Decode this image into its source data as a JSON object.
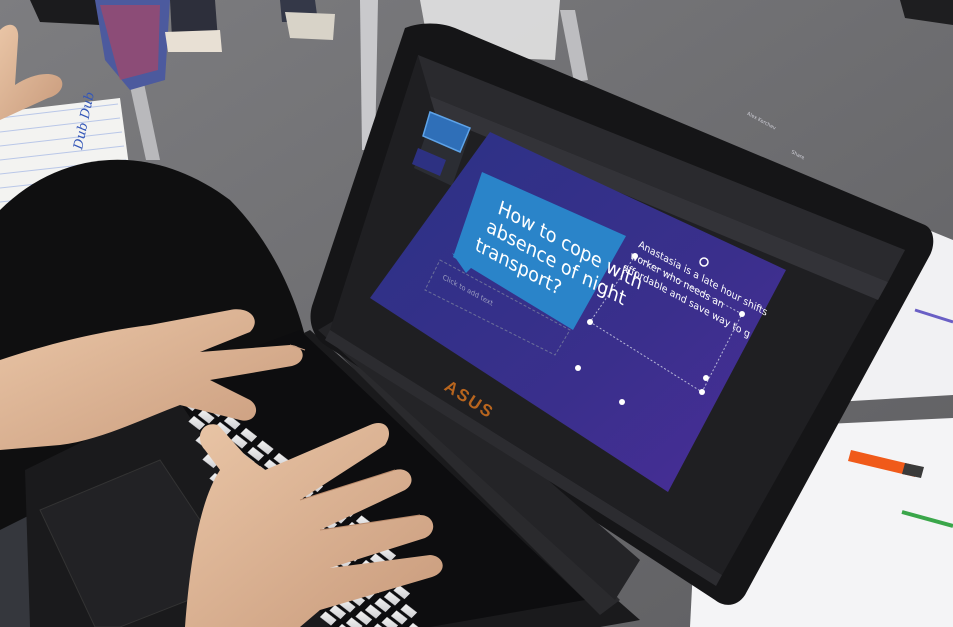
{
  "photo": {
    "laptop_brand": "ASUS"
  },
  "slide": {
    "title_lines": [
      "How to cope with",
      "absence of night",
      "transport?"
    ],
    "body_lines": [
      "Anastasia is a late hour shifts",
      "worker who needs an",
      "affordable and save way to g"
    ],
    "subtitle_placeholder": "Click to add text",
    "user_name": "Alex Korchev",
    "share_label": "Share"
  },
  "notepad": {
    "handwriting": "Dub Dub"
  },
  "colors": {
    "floor": "#6f6f72",
    "slide_bg": "#2d2f7a",
    "title_box": "#2a84c9",
    "laptop_body": "#151517",
    "marker_orange": "#f05a1a",
    "marker_green": "#3aa64a"
  }
}
